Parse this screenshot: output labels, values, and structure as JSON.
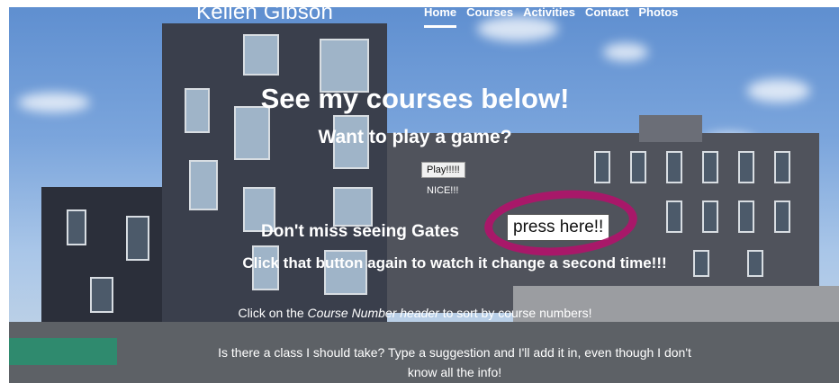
{
  "brand": "Kellen Gibson",
  "nav": {
    "items": [
      {
        "label": "Home",
        "active": true
      },
      {
        "label": "Courses"
      },
      {
        "label": "Activities"
      },
      {
        "label": "Contact"
      },
      {
        "label": "Photos"
      }
    ]
  },
  "hero": {
    "title": "See my courses below!",
    "game_prompt": "Want to play a game?",
    "play_button": "Play!!!!!",
    "play_result": "NICE!!!",
    "gates_text": "Don't miss seeing Gates",
    "press_button": "press here!!",
    "change_text": "Click that button again to watch it change a second time!!!",
    "sort_prefix": "Click on the ",
    "sort_emphasis": "Course Number header",
    "sort_suffix": " to sort by course numbers!",
    "suggest_text": "Is there a class I should take? Type a suggestion and I'll add it in, even though I don't know all the info!"
  },
  "colors": {
    "highlight_circle": "#b0146a",
    "text": "#ffffff"
  }
}
